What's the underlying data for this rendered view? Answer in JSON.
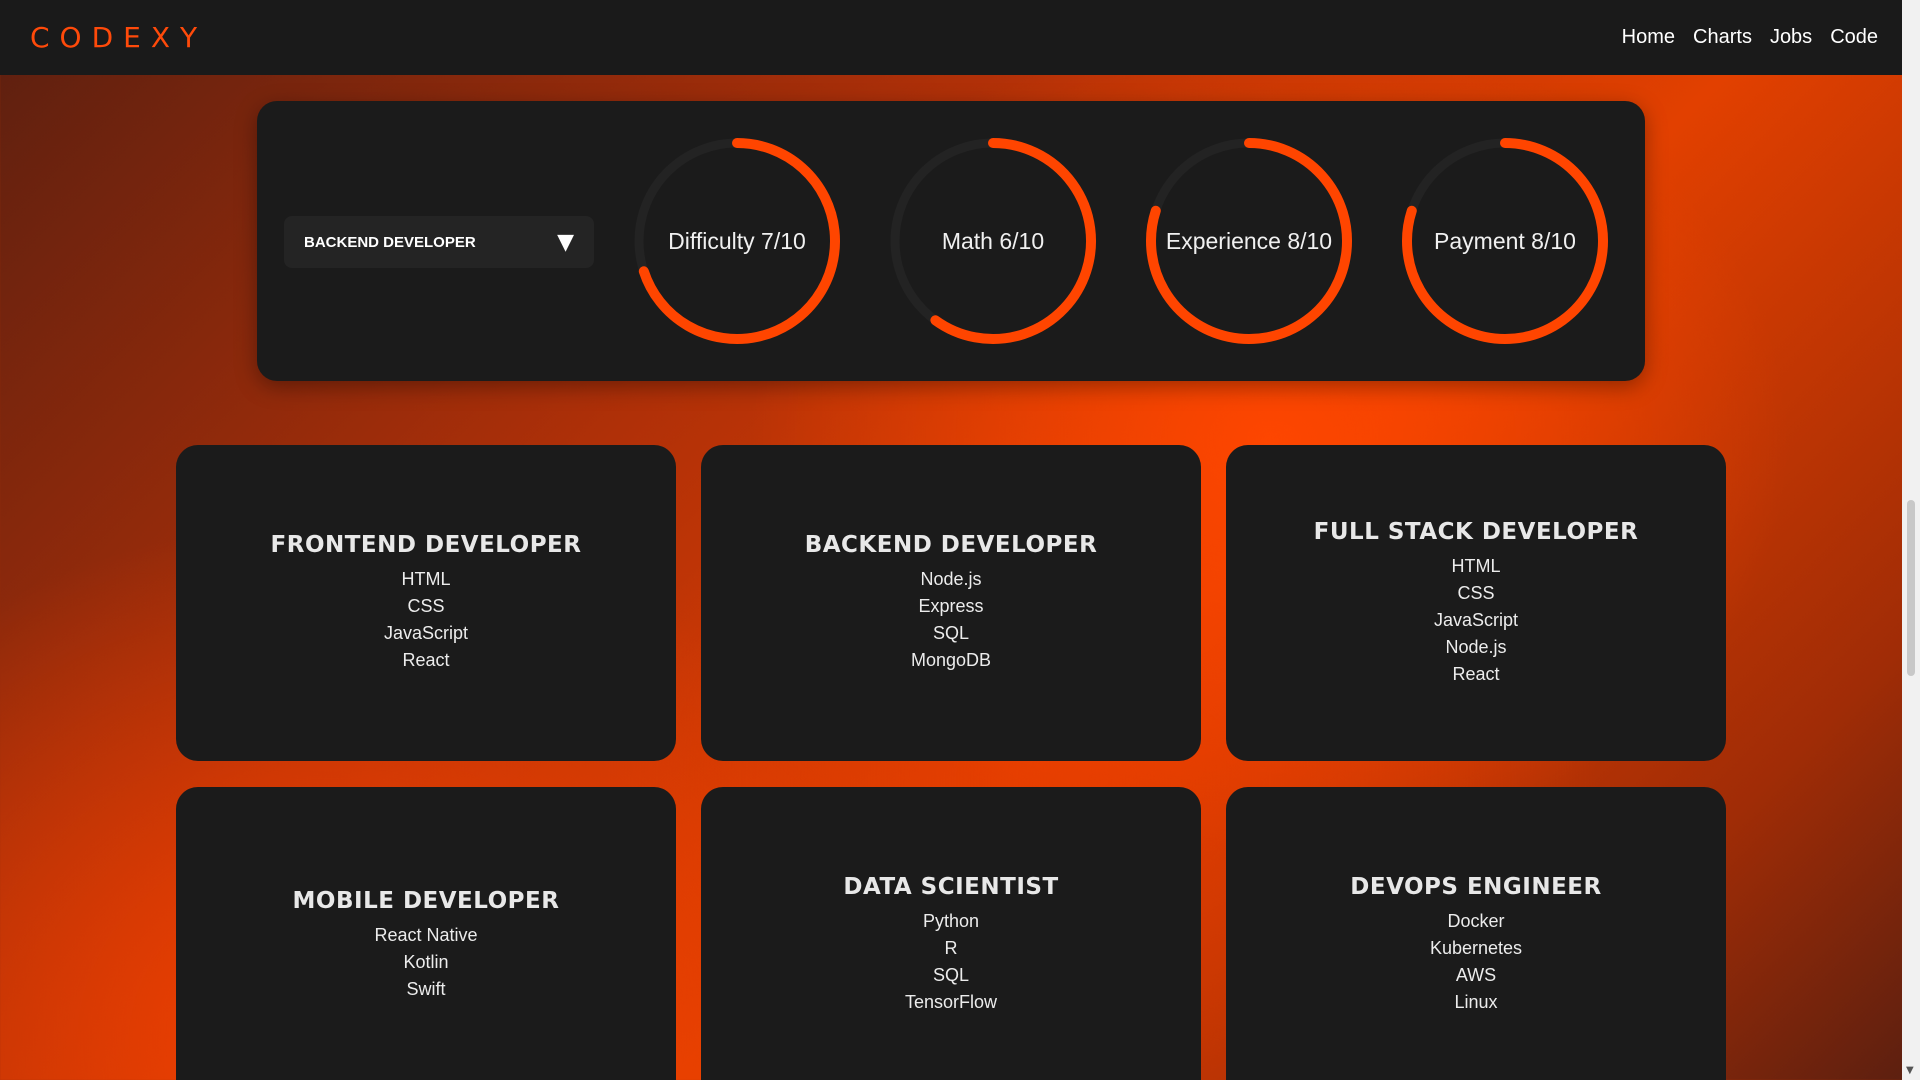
{
  "nav": {
    "brand": "CODEXY",
    "links": [
      "Home",
      "Charts",
      "Jobs",
      "Code"
    ]
  },
  "stats": {
    "selected_role": "BACKEND DEVELOPER",
    "dropdown_icon": "triangle-down-icon",
    "accent_color": "#ff4500",
    "track_color": "#232323",
    "gauges": [
      {
        "label": "Difficulty 7/10",
        "value": 7,
        "max": 10
      },
      {
        "label": "Math 6/10",
        "value": 6,
        "max": 10
      },
      {
        "label": "Experience 8/10",
        "value": 8,
        "max": 10
      },
      {
        "label": "Payment 8/10",
        "value": 8,
        "max": 10
      }
    ]
  },
  "cards": [
    {
      "title": "FRONTEND DEVELOPER",
      "skills": [
        "HTML",
        "CSS",
        "JavaScript",
        "React"
      ]
    },
    {
      "title": "BACKEND DEVELOPER",
      "skills": [
        "Node.js",
        "Express",
        "SQL",
        "MongoDB"
      ]
    },
    {
      "title": "FULL STACK DEVELOPER",
      "skills": [
        "HTML",
        "CSS",
        "JavaScript",
        "Node.js",
        "React"
      ]
    },
    {
      "title": "MOBILE DEVELOPER",
      "skills": [
        "React Native",
        "Kotlin",
        "Swift"
      ]
    },
    {
      "title": "DATA SCIENTIST",
      "skills": [
        "Python",
        "R",
        "SQL",
        "TensorFlow"
      ]
    },
    {
      "title": "DEVOPS ENGINEER",
      "skills": [
        "Docker",
        "Kubernetes",
        "AWS",
        "Linux"
      ]
    }
  ]
}
